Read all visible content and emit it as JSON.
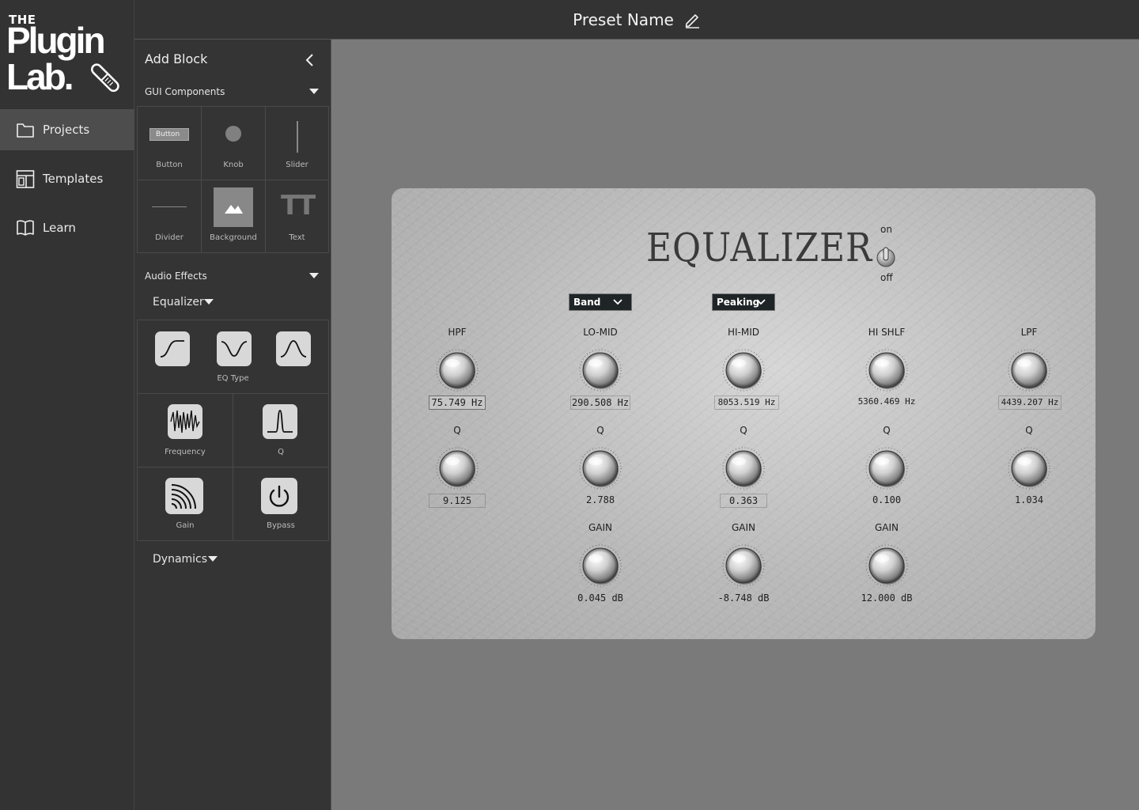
{
  "logo": {
    "the": "THE",
    "plugin": "Plugin",
    "lab": "Lab."
  },
  "nav": {
    "items": [
      {
        "label": "Projects",
        "icon": "folder-icon",
        "active": true
      },
      {
        "label": "Templates",
        "icon": "layout-icon",
        "active": false
      },
      {
        "label": "Learn",
        "icon": "book-icon",
        "active": false
      }
    ]
  },
  "header": {
    "preset_name": "Preset Name",
    "edit_icon": "pencil-icon"
  },
  "panel": {
    "title": "Add Block",
    "gui_section": "GUI Components",
    "gui_items": [
      "Button",
      "Knob",
      "Slider",
      "Divider",
      "Background",
      "Text"
    ],
    "button_preview": "Button",
    "text_preview": "TT",
    "audio_section": "Audio Effects",
    "equalizer": "Equalizer",
    "eq_type_label": "EQ Type",
    "eq_items": [
      "Frequency",
      "Q",
      "Gain",
      "Bypass"
    ],
    "dynamics": "Dynamics"
  },
  "plugin": {
    "title": "EQUALIZER",
    "switch_on": "on",
    "switch_off": "off",
    "switch_state": "on",
    "band_dropdown": "Band",
    "peaking_dropdown": "Peaking",
    "columns": [
      {
        "name": "HPF",
        "freq": "75.749 Hz",
        "q_label": "Q",
        "q": "9.125"
      },
      {
        "name": "LO-MID",
        "freq": "290.508 Hz",
        "q_label": "Q",
        "q": "2.788",
        "gain_label": "GAIN",
        "gain": "0.045 dB"
      },
      {
        "name": "HI-MID",
        "freq": "8053.519 Hz",
        "q_label": "Q",
        "q": "0.363",
        "gain_label": "GAIN",
        "gain": "-8.748 dB"
      },
      {
        "name": "HI SHLF",
        "freq": "5360.469 Hz",
        "q_label": "Q",
        "q": "0.100",
        "gain_label": "GAIN",
        "gain": "12.000 dB"
      },
      {
        "name": "LPF",
        "freq": "4439.207 Hz",
        "q_label": "Q",
        "q": "1.034"
      }
    ]
  },
  "colors": {
    "sidebar": "#333333",
    "canvas": "#7a7a7a",
    "active_nav": "#4d4d4d",
    "dropdown": "#1f2427"
  }
}
